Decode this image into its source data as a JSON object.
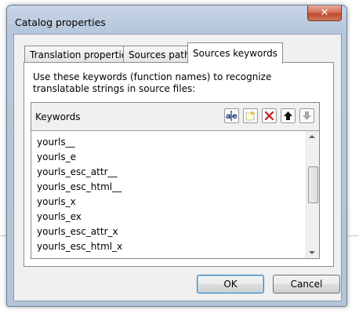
{
  "window": {
    "title": "Catalog properties",
    "close_label": "✕"
  },
  "tabs": [
    {
      "label": "Translation properties",
      "active": false
    },
    {
      "label": "Sources paths",
      "active": false
    },
    {
      "label": "Sources keywords",
      "active": true
    }
  ],
  "sources_keywords": {
    "description": "Use these keywords (function names) to recognize translatable strings in source files:",
    "list_header": "Keywords",
    "toolbar": [
      "edit-item-icon",
      "new-item-icon",
      "delete-item-icon",
      "move-up-icon",
      "move-down-icon"
    ],
    "items": [
      "yourls__",
      "yourls_e",
      "yourls_esc_attr__",
      "yourls_esc_html__",
      "yourls_x",
      "yourls_ex",
      "yourls_esc_attr_x",
      "yourls_esc_html_x"
    ]
  },
  "buttons": {
    "ok": "OK",
    "cancel": "Cancel"
  },
  "colors": {
    "frame": "#b9c9dc",
    "close": "#c7502f",
    "accent": "#3c7fb1"
  }
}
